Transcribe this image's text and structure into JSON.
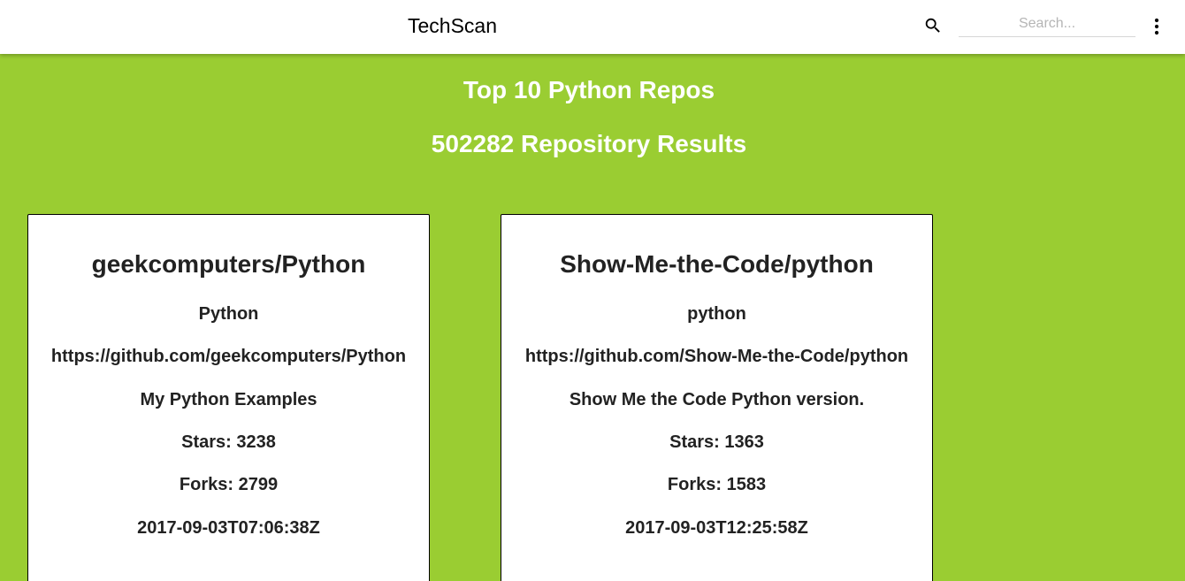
{
  "app": {
    "title": "TechScan",
    "search_placeholder": "Search...",
    "search_value": ""
  },
  "page": {
    "heading": "Top 10 Python Repos",
    "results_text": "502282 Repository Results"
  },
  "repos": [
    {
      "name": "geekcomputers/Python",
      "language": "Python",
      "url": "https://github.com/geekcomputers/Python",
      "description": "My Python Examples",
      "stars": "Stars: 3238",
      "forks": "Forks: 2799",
      "date": "2017-09-03T07:06:38Z"
    },
    {
      "name": "Show-Me-the-Code/python",
      "language": "python",
      "url": "https://github.com/Show-Me-the-Code/python",
      "description": "Show Me the Code Python version.",
      "stars": "Stars: 1363",
      "forks": "Forks: 1583",
      "date": "2017-09-03T12:25:58Z"
    }
  ],
  "colors": {
    "background": "#9acd32",
    "appbar": "#ffffff",
    "card": "#ffffff"
  },
  "icons": {
    "search": "search-icon",
    "more": "more-vert-icon"
  }
}
